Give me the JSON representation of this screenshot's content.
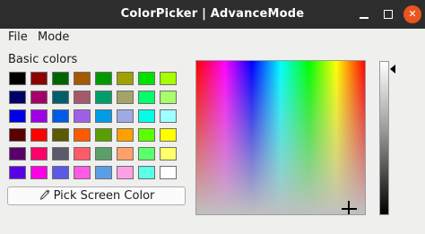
{
  "window": {
    "title": "ColorPicker | AdvanceMode",
    "minimize_glyph": "",
    "maximize_glyph": "",
    "close_glyph": "✕"
  },
  "menu": {
    "items": [
      "File",
      "Mode"
    ]
  },
  "basic_colors": {
    "label": "Basic colors",
    "rows": [
      [
        "#000000",
        "#8b0000",
        "#006400",
        "#a35a00",
        "#009900",
        "#a0a000",
        "#00e000",
        "#a6ff00"
      ],
      [
        "#00006a",
        "#a5006a",
        "#005f6a",
        "#a5596a",
        "#009f6a",
        "#a5a36a",
        "#00ff6a",
        "#a6ff6a"
      ],
      [
        "#0000e6",
        "#a000e6",
        "#005ce6",
        "#a060e6",
        "#009ce6",
        "#a0a8e6",
        "#00ffe6",
        "#a0ffff"
      ],
      [
        "#5a0000",
        "#ff0000",
        "#5a5a00",
        "#ff5a00",
        "#5a9f00",
        "#ffa000",
        "#5aff00",
        "#ffff00"
      ],
      [
        "#5a006a",
        "#ff006a",
        "#5a5a6a",
        "#ff5a6a",
        "#5a9f6a",
        "#ffa06a",
        "#5aff6a",
        "#ffff6a"
      ],
      [
        "#5a00e6",
        "#ff00e6",
        "#5a5ae6",
        "#ff5ae6",
        "#5a9fe6",
        "#ffa0e6",
        "#5affe6",
        "#ffffff"
      ]
    ]
  },
  "pick_button": {
    "label": "Pick Screen Color",
    "icon": "eyedropper-icon"
  },
  "spectrum": {
    "icon": "crosshair-icon"
  },
  "luminance": {
    "icon": "arrow-left-icon"
  },
  "colors": {
    "titlebar": "#2d2d2d",
    "close_button": "#e95420",
    "window_bg": "#efefee"
  }
}
